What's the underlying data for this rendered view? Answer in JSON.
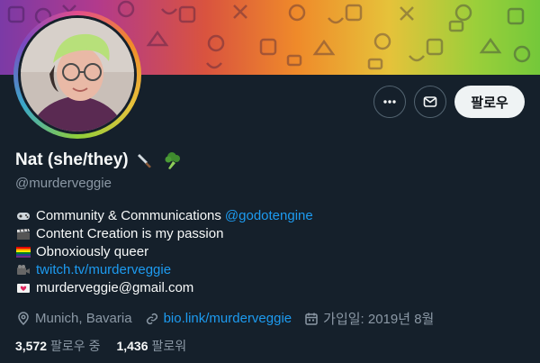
{
  "profile": {
    "display_name": "Nat (she/they)",
    "name_emojis": [
      "knife-emoji",
      "broccoli-emoji"
    ],
    "handle": "@murderveggie"
  },
  "actions": {
    "more_icon": "more-horizontal-icon",
    "message_icon": "envelope-icon",
    "follow_label": "팔로우"
  },
  "bio": {
    "line1_text": "Community & Communications ",
    "line1_mention": "@godotengine",
    "line2_text": "Content Creation is my passion",
    "line3_text": "Obnoxiously queer",
    "line4_link": "twitch.tv/murderveggie",
    "line5_text": "murderveggie@gmail.com"
  },
  "meta": {
    "location": "Munich, Bavaria",
    "website": "bio.link/murderveggie",
    "joined": "가입일: 2019년 8월"
  },
  "stats": {
    "following_count": "3,572",
    "following_label": "팔로우 중",
    "followers_count": "1,436",
    "followers_label": "팔로워"
  },
  "colors": {
    "background": "#15202b",
    "link": "#1d9bf0",
    "secondary_text": "#8b98a5"
  }
}
